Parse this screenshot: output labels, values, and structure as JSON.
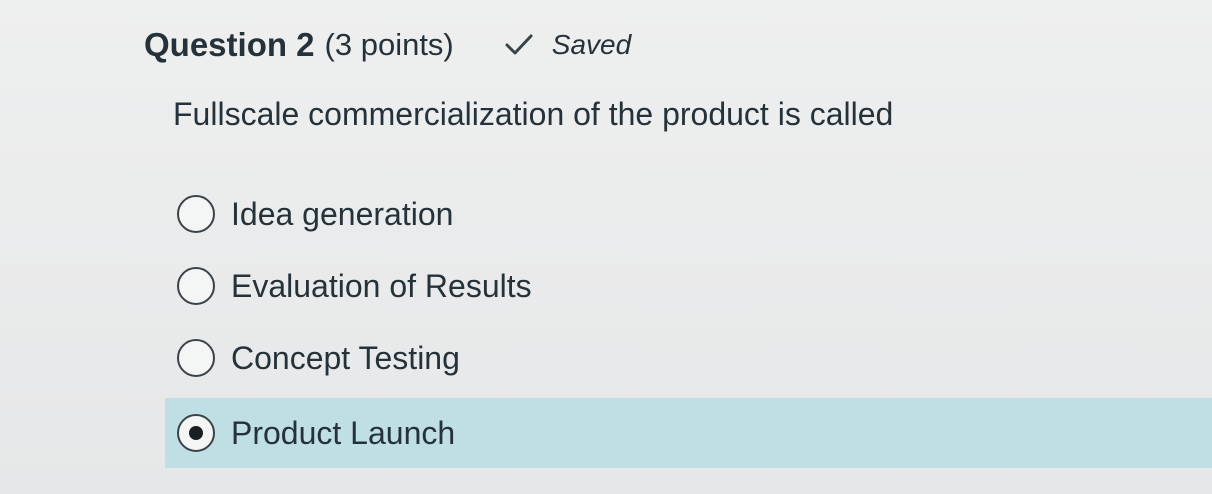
{
  "question": {
    "title": "Question 2",
    "points": "(3 points)",
    "status": "Saved",
    "prompt": "Fullscale commercialization of the product is called"
  },
  "options": [
    {
      "label": "Idea generation",
      "selected": false
    },
    {
      "label": "Evaluation of Results",
      "selected": false
    },
    {
      "label": "Concept Testing",
      "selected": false
    },
    {
      "label": "Product Launch",
      "selected": true
    }
  ],
  "colors": {
    "selected_background": "#bfdfe5",
    "text": "#26323a"
  }
}
